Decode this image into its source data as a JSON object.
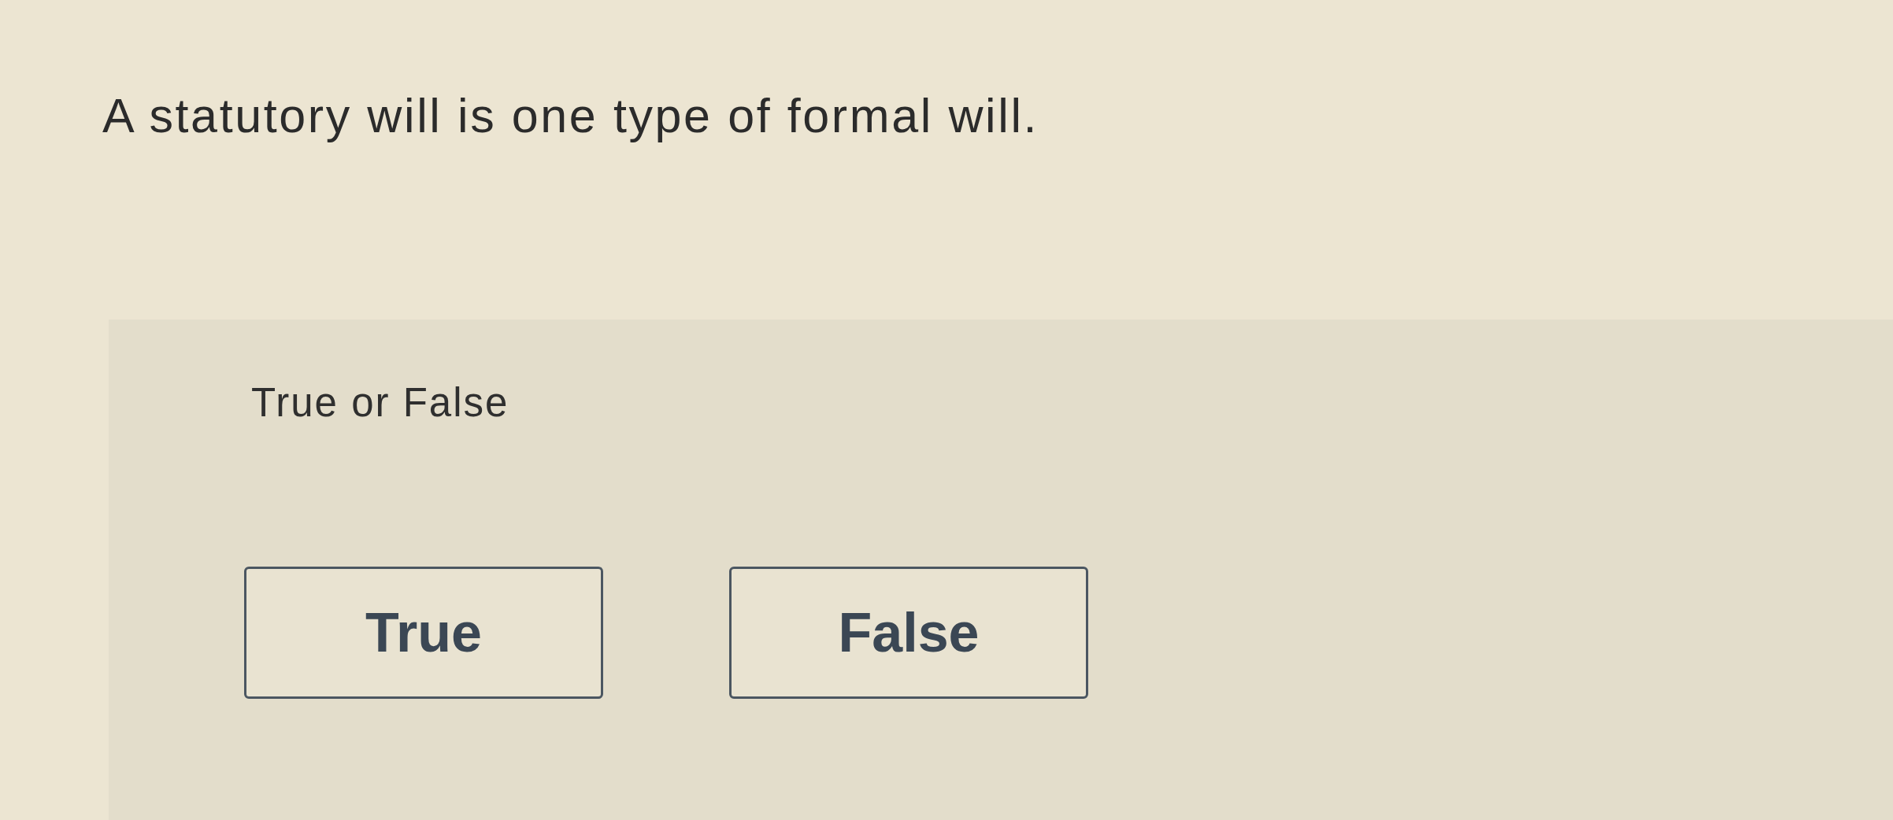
{
  "question": {
    "text": "A statutory will is one type of formal will."
  },
  "answer_panel": {
    "prompt": "True or False",
    "options": [
      {
        "label": "True",
        "selected": false
      },
      {
        "label": "False",
        "selected": false
      }
    ]
  }
}
